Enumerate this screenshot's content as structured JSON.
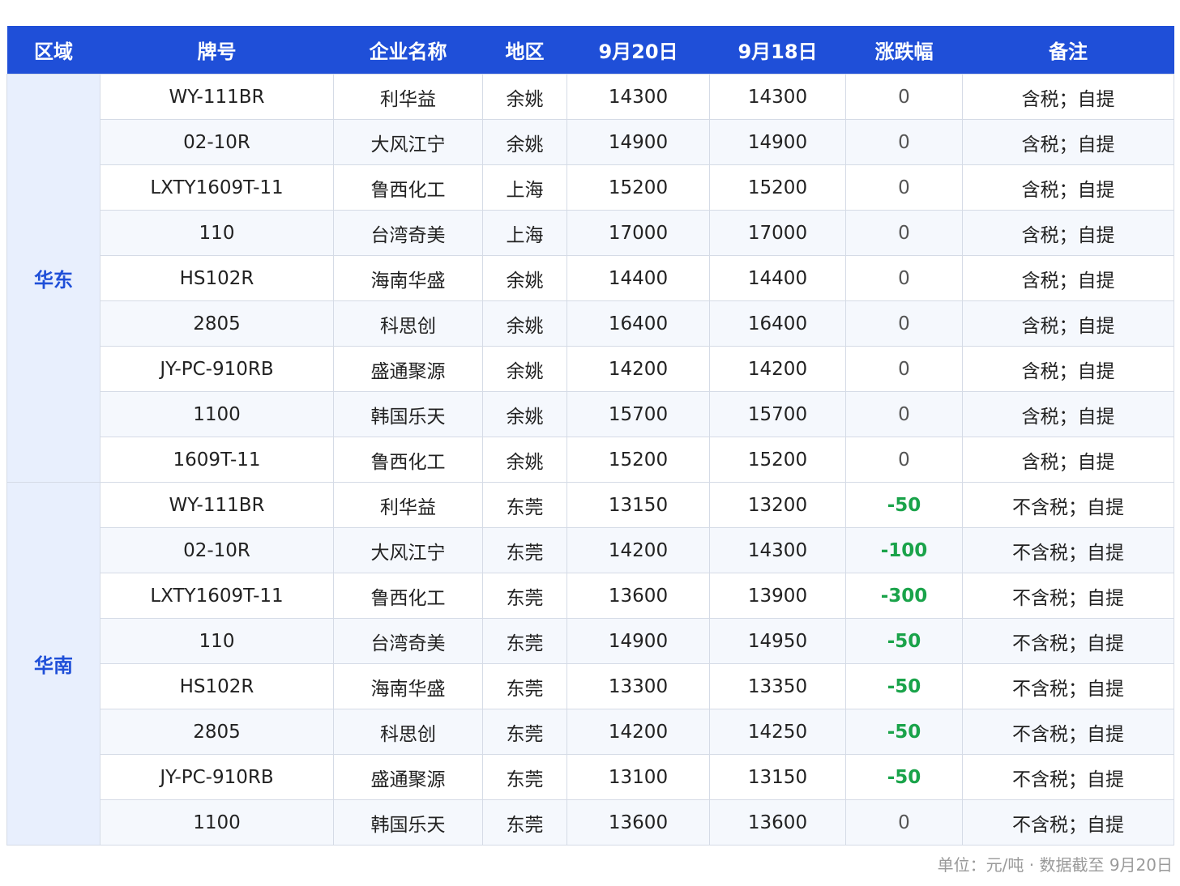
{
  "table": {
    "headers": [
      "区域",
      "牌号",
      "企业名称",
      "地区",
      "9月20日",
      "9月18日",
      "涨跌幅",
      "备注"
    ],
    "groups": [
      {
        "region": "华东",
        "rows": [
          {
            "grade": "WY-111BR",
            "company": "利华益",
            "area": "余姚",
            "price_0920": "14300",
            "price_0918": "14300",
            "change": "0",
            "note": "含税；自提"
          },
          {
            "grade": "02-10R",
            "company": "大风江宁",
            "area": "余姚",
            "price_0920": "14900",
            "price_0918": "14900",
            "change": "0",
            "note": "含税；自提"
          },
          {
            "grade": "LXTY1609T-11",
            "company": "鲁西化工",
            "area": "上海",
            "price_0920": "15200",
            "price_0918": "15200",
            "change": "0",
            "note": "含税；自提"
          },
          {
            "grade": "110",
            "company": "台湾奇美",
            "area": "上海",
            "price_0920": "17000",
            "price_0918": "17000",
            "change": "0",
            "note": "含税；自提"
          },
          {
            "grade": "HS102R",
            "company": "海南华盛",
            "area": "余姚",
            "price_0920": "14400",
            "price_0918": "14400",
            "change": "0",
            "note": "含税；自提"
          },
          {
            "grade": "2805",
            "company": "科思创",
            "area": "余姚",
            "price_0920": "16400",
            "price_0918": "16400",
            "change": "0",
            "note": "含税；自提"
          },
          {
            "grade": "JY-PC-910RB",
            "company": "盛通聚源",
            "area": "余姚",
            "price_0920": "14200",
            "price_0918": "14200",
            "change": "0",
            "note": "含税；自提"
          },
          {
            "grade": "1100",
            "company": "韩国乐天",
            "area": "余姚",
            "price_0920": "15700",
            "price_0918": "15700",
            "change": "0",
            "note": "含税；自提"
          },
          {
            "grade": "1609T-11",
            "company": "鲁西化工",
            "area": "余姚",
            "price_0920": "15200",
            "price_0918": "15200",
            "change": "0",
            "note": "含税；自提"
          }
        ]
      },
      {
        "region": "华南",
        "rows": [
          {
            "grade": "WY-111BR",
            "company": "利华益",
            "area": "东莞",
            "price_0920": "13150",
            "price_0918": "13200",
            "change": "-50",
            "note": "不含税；自提"
          },
          {
            "grade": "02-10R",
            "company": "大风江宁",
            "area": "东莞",
            "price_0920": "14200",
            "price_0918": "14300",
            "change": "-100",
            "note": "不含税；自提"
          },
          {
            "grade": "LXTY1609T-11",
            "company": "鲁西化工",
            "area": "东莞",
            "price_0920": "13600",
            "price_0918": "13900",
            "change": "-300",
            "note": "不含税；自提"
          },
          {
            "grade": "110",
            "company": "台湾奇美",
            "area": "东莞",
            "price_0920": "14900",
            "price_0918": "14950",
            "change": "-50",
            "note": "不含税；自提"
          },
          {
            "grade": "HS102R",
            "company": "海南华盛",
            "area": "东莞",
            "price_0920": "13300",
            "price_0918": "13350",
            "change": "-50",
            "note": "不含税；自提"
          },
          {
            "grade": "2805",
            "company": "科思创",
            "area": "东莞",
            "price_0920": "14200",
            "price_0918": "14250",
            "change": "-50",
            "note": "不含税；自提"
          },
          {
            "grade": "JY-PC-910RB",
            "company": "盛通聚源",
            "area": "东莞",
            "price_0920": "13100",
            "price_0918": "13150",
            "change": "-50",
            "note": "不含税；自提"
          },
          {
            "grade": "1100",
            "company": "韩国乐天",
            "area": "东莞",
            "price_0920": "13600",
            "price_0918": "13600",
            "change": "0",
            "note": "不含税；自提"
          }
        ]
      }
    ]
  },
  "footnote": "单位：元/吨 · 数据截至 9月20日",
  "colors": {
    "header_bg": "#1f4fd8",
    "region_text": "#1f4fd8",
    "region_bg": "#e8effd",
    "negative_change": "#1aa34a",
    "border": "#d5dbe6"
  }
}
